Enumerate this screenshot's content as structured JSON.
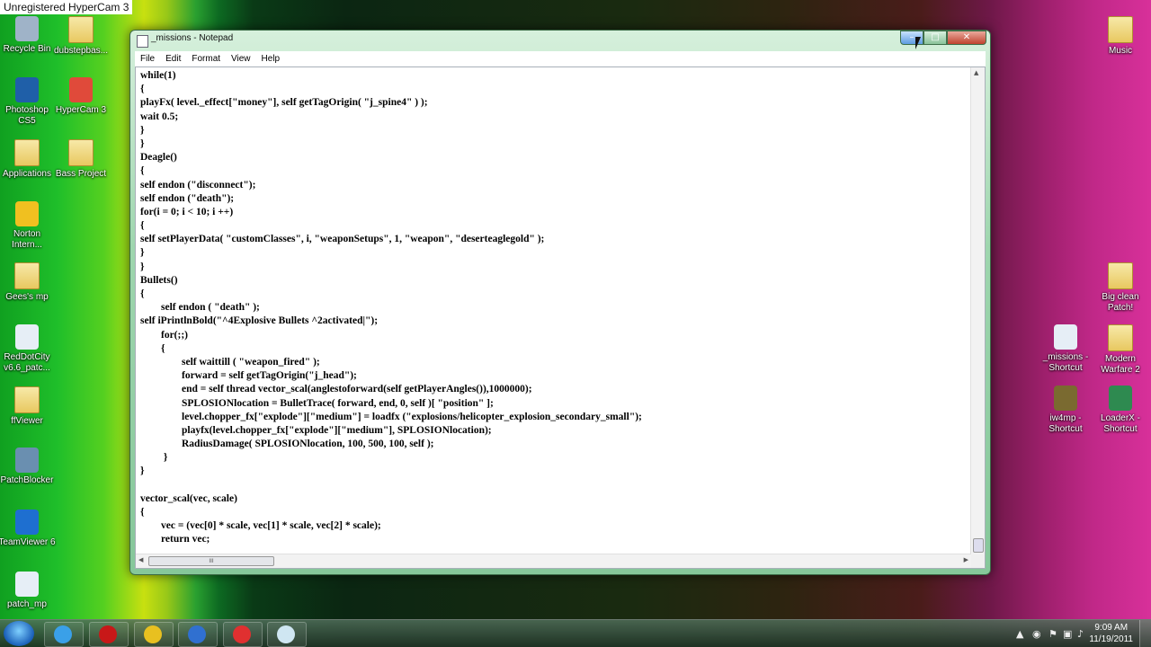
{
  "hypercam_label": "Unregistered HyperCam 3",
  "desktop_icons_left": [
    {
      "label": "Recycle Bin",
      "icon": "recycle-bin-icon"
    },
    {
      "label": "dubstepbas...",
      "icon": "folder-icon"
    },
    {
      "label": "Photoshop CS5",
      "icon": "photoshop-icon"
    },
    {
      "label": "HyperCam 3",
      "icon": "hypercam-icon"
    },
    {
      "label": "Applications",
      "icon": "folder-icon"
    },
    {
      "label": "Bass Project",
      "icon": "folder-icon"
    },
    {
      "label": "Norton Intern...",
      "icon": "norton-icon"
    },
    {
      "label": "Gees's mp",
      "icon": "folder-icon"
    },
    {
      "label": "RedDotCity v6.6_patc...",
      "icon": "file-icon"
    },
    {
      "label": "ffViewer",
      "icon": "folder-icon"
    },
    {
      "label": "PatchBlocker",
      "icon": "app-icon"
    },
    {
      "label": "TeamViewer 6",
      "icon": "teamviewer-icon"
    },
    {
      "label": "patch_mp",
      "icon": "file-icon"
    }
  ],
  "desktop_icons_right": [
    {
      "label": "Music",
      "icon": "folder-icon"
    },
    {
      "label": "Big clean Patch!",
      "icon": "folder-icon"
    },
    {
      "label": "_missions - Shortcut",
      "icon": "file-shortcut-icon"
    },
    {
      "label": "Modern Warfare 2",
      "icon": "folder-icon"
    },
    {
      "label": "iw4mp - Shortcut",
      "icon": "game-shortcut-icon"
    },
    {
      "label": "LoaderX - Shortcut",
      "icon": "app-shortcut-icon"
    }
  ],
  "window": {
    "title": "_missions - Notepad",
    "min_label": "–",
    "max_label": "□",
    "close_label": "✕"
  },
  "menu": [
    "File",
    "Edit",
    "Format",
    "View",
    "Help"
  ],
  "code_lines": [
    "while(1)",
    "{",
    "playFx( level._effect[\"money\"], self getTagOrigin( \"j_spine4\" ) );",
    "wait 0.5;",
    "}",
    "}",
    "Deagle()",
    "{",
    "self endon (\"disconnect\");",
    "self endon (\"death\");",
    "for(i = 0; i < 10; i ++)",
    "{",
    "self setPlayerData( \"customClasses\", i, \"weaponSetups\", 1, \"weapon\", \"deserteaglegold\" );",
    "}",
    "}",
    "Bullets()",
    "{",
    "        self endon ( \"death\" );",
    "self iPrintlnBold(\"^4Explosive Bullets ^2activated|\");",
    "        for(;;)",
    "        {",
    "                self waittill ( \"weapon_fired\" );",
    "                forward = self getTagOrigin(\"j_head\");",
    "                end = self thread vector_scal(anglestoforward(self getPlayerAngles()),1000000);",
    "                SPLOSIONlocation = BulletTrace( forward, end, 0, self )[ \"position\" ];",
    "                level.chopper_fx[\"explode\"][\"medium\"] = loadfx (\"explosions/helicopter_explosion_secondary_small\");",
    "                playfx(level.chopper_fx[\"explode\"][\"medium\"], SPLOSIONlocation);",
    "                RadiusDamage( SPLOSIONlocation, 100, 500, 100, self );",
    "         }",
    "}",
    "",
    "vector_scal(vec, scale)",
    "{",
    "        vec = (vec[0] * scale, vec[1] * scale, vec[2] * scale);",
    "        return vec;"
  ],
  "hscroll_grip": "III",
  "taskbar_apps": [
    {
      "name": "internet-explorer",
      "icon": "ie-icon",
      "color": "#3aa0e8"
    },
    {
      "name": "red-app",
      "icon": "red-app-icon",
      "color": "#c81818"
    },
    {
      "name": "chrome",
      "icon": "chrome-icon",
      "color": "#e8c020"
    },
    {
      "name": "itunes",
      "icon": "itunes-icon",
      "color": "#3070d0"
    },
    {
      "name": "hypercam",
      "icon": "record-icon",
      "color": "#e03030"
    },
    {
      "name": "notepad",
      "icon": "notepad-icon",
      "color": "#cfe6f2"
    }
  ],
  "clock": {
    "time": "9:09 AM",
    "date": "11/19/2011"
  }
}
